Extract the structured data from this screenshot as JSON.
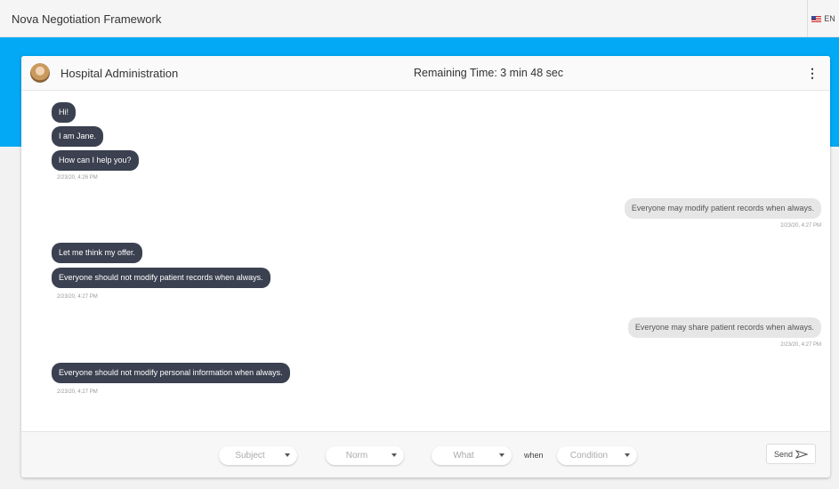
{
  "app": {
    "title": "Nova Negotiation Framework",
    "language": "EN"
  },
  "chat": {
    "partner_name": "Hospital Administration",
    "remaining_time": "Remaining Time: 3 min 48 sec"
  },
  "messages": [
    {
      "text": "Hi!"
    },
    {
      "text": "I am Jane."
    },
    {
      "text": "How can I help you?"
    },
    {
      "time": "2/23/20, 4:26 PM"
    },
    {
      "text": "Everyone may modify patient records when always."
    },
    {
      "time": "2/23/20, 4:27 PM"
    },
    {
      "text": "Let me think my offer."
    },
    {
      "text": "Everyone should not modify patient records when always."
    },
    {
      "time": "2/23/20, 4:27 PM"
    },
    {
      "text": "Everyone may share patient records when always."
    },
    {
      "time": "2/23/20, 4:27 PM"
    },
    {
      "text": "Everyone should not modify personal information when always."
    },
    {
      "time": "2/23/20, 4:27 PM"
    }
  ],
  "composer": {
    "subject_placeholder": "Subject",
    "norm_placeholder": "Norm",
    "what_placeholder": "What",
    "when_label": "when",
    "condition_placeholder": "Condition",
    "send_label": "Send"
  },
  "colors": {
    "accent": "#03a9f4",
    "incoming_bubble": "#3b4150",
    "outgoing_bubble": "#e6e6e6"
  }
}
